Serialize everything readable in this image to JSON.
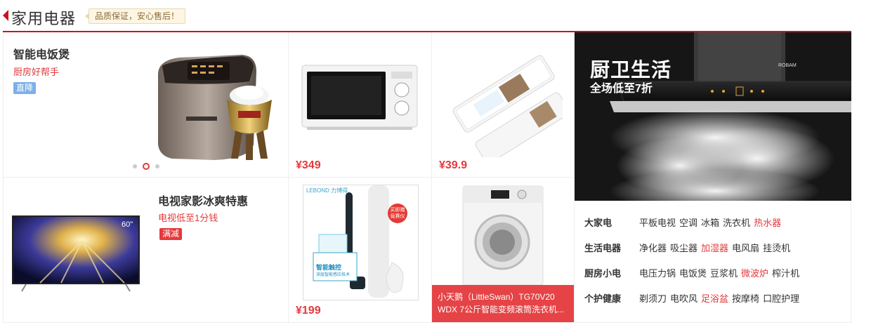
{
  "header": {
    "title": "家用电器",
    "slogan": "品质保证，安心售后！"
  },
  "products": {
    "rice_cooker": {
      "title": "智能电饭煲",
      "subtitle": "厨房好帮手",
      "tag": "直降",
      "carousel": {
        "count": 3,
        "active": 2
      }
    },
    "microwave": {
      "price": "¥349"
    },
    "water_purifier": {
      "price": "¥39.9"
    },
    "tv": {
      "title": "电视家影冰爽特惠",
      "subtitle": "电视低至1分钱",
      "tag": "满减",
      "size_label": "60\""
    },
    "toothbrush": {
      "price": "¥199",
      "brand": "LEBOND 力博得",
      "badge": "买即赠 竟赛仪",
      "box_text": "智能触控",
      "box_sub": "深层智能感应技术"
    },
    "washer": {
      "caption_line1": "小天鹅（LittleSwan）TG70V20",
      "caption_line2": "WDX 7公斤智能变频滚筒洗衣机..."
    }
  },
  "banner": {
    "title": "厨卫生活",
    "subtitle": "全场低至7折",
    "hood_brand": "ROBAM"
  },
  "categories": [
    {
      "name": "大家电",
      "items": [
        {
          "label": "平板电视",
          "hot": false
        },
        {
          "label": "空调",
          "hot": false
        },
        {
          "label": "冰箱",
          "hot": false
        },
        {
          "label": "洗衣机",
          "hot": false
        },
        {
          "label": "热水器",
          "hot": true
        }
      ]
    },
    {
      "name": "生活电器",
      "items": [
        {
          "label": "净化器",
          "hot": false
        },
        {
          "label": "吸尘器",
          "hot": false
        },
        {
          "label": "加湿器",
          "hot": true
        },
        {
          "label": "电风扇",
          "hot": false
        },
        {
          "label": "挂烫机",
          "hot": false
        }
      ]
    },
    {
      "name": "厨房小电",
      "items": [
        {
          "label": "电压力锅",
          "hot": false
        },
        {
          "label": "电饭煲",
          "hot": false
        },
        {
          "label": "豆浆机",
          "hot": false
        },
        {
          "label": "微波炉",
          "hot": true
        },
        {
          "label": "榨汁机",
          "hot": false
        }
      ]
    },
    {
      "name": "个护健康",
      "items": [
        {
          "label": "剃须刀",
          "hot": false
        },
        {
          "label": "电吹风",
          "hot": false
        },
        {
          "label": "足浴盆",
          "hot": true
        },
        {
          "label": "按摩椅",
          "hot": false
        },
        {
          "label": "口腔护理",
          "hot": false
        }
      ]
    }
  ],
  "colors": {
    "accent": "#c9151e",
    "price": "#e4393c",
    "tag_blue": "#7bb0e8"
  }
}
